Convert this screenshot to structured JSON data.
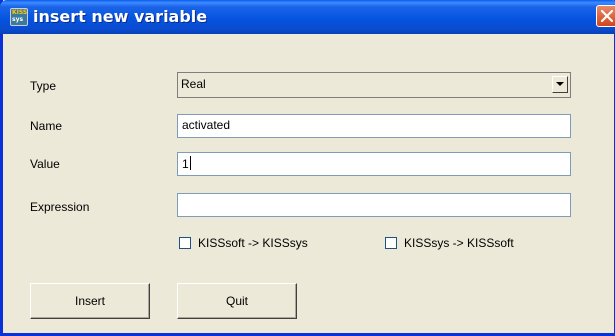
{
  "window": {
    "title": "insert new variable",
    "app_icon_text_top": "KISS",
    "app_icon_text_bottom": "sys"
  },
  "form": {
    "type_label": "Type",
    "type_value": "Real",
    "name_label": "Name",
    "name_value": "activated",
    "value_label": "Value",
    "value_value": "1",
    "expression_label": "Expression",
    "expression_value": ""
  },
  "checkboxes": [
    {
      "label": "KISSsoft -> KISSsys",
      "checked": false
    },
    {
      "label": "KISSsys -> KISSsoft",
      "checked": false
    }
  ],
  "buttons": {
    "insert_label": "Insert",
    "quit_label": "Quit"
  },
  "colors": {
    "title_bar": "#0554e0",
    "dialog_bg": "#ece9d8",
    "close_button": "#d2461c"
  }
}
